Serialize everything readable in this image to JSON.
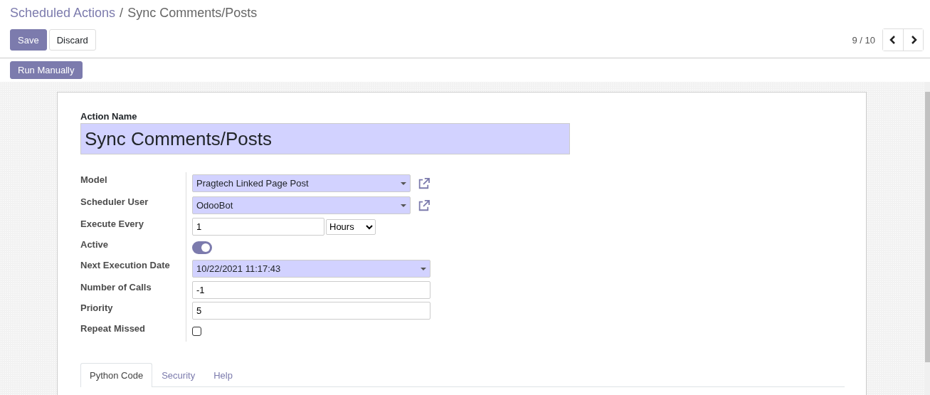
{
  "breadcrumb": {
    "parent": "Scheduled Actions",
    "separator": "/",
    "current": "Sync Comments/Posts"
  },
  "buttons": {
    "save": "Save",
    "discard": "Discard"
  },
  "pager": {
    "value": "9 / 10"
  },
  "actions": [
    "Run Manually"
  ],
  "form": {
    "name_label": "Action Name",
    "name_value": "Sync Comments/Posts",
    "fields": [
      {
        "kind": "many2one",
        "label": "Model",
        "value": "Pragtech Linked Page Post"
      },
      {
        "kind": "many2one",
        "label": "Scheduler User",
        "value": "OdooBot"
      },
      {
        "kind": "interval",
        "label": "Execute Every",
        "value": "1",
        "unit": "Hours"
      },
      {
        "kind": "toggle",
        "label": "Active",
        "on": true
      },
      {
        "kind": "datetime",
        "label": "Next Execution Date",
        "value": "10/22/2021 11:17:43"
      },
      {
        "kind": "text",
        "label": "Number of Calls",
        "value": "-1"
      },
      {
        "kind": "text",
        "label": "Priority",
        "value": "5"
      },
      {
        "kind": "checkbox",
        "label": "Repeat Missed",
        "checked": false
      }
    ],
    "tabs": [
      {
        "label": "Python Code",
        "selected": true
      },
      {
        "label": "Security",
        "selected": false
      },
      {
        "label": "Help",
        "selected": false
      }
    ]
  }
}
